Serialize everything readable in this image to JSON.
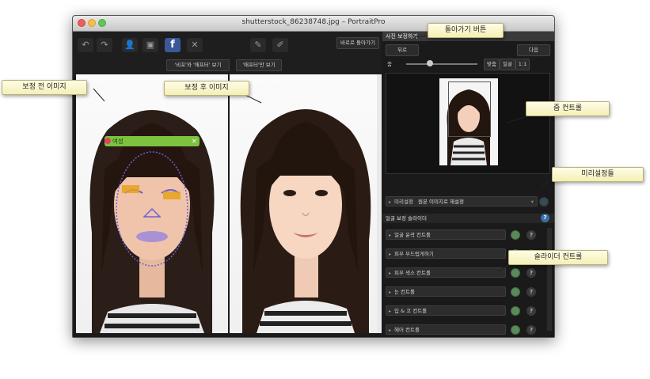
{
  "window": {
    "title": "shutterstock_86238748.jpg – PortraitPro"
  },
  "toolbar": {
    "undo_icon": "undo-icon",
    "redo_icon": "redo-icon",
    "facebook_label": "f",
    "close_label": "✕",
    "revert_label": "바로로 돌아가기",
    "tab_before_after": "'비포'와 '애프터' 보기",
    "tab_after_only": "'애프터'만 보기"
  },
  "photo": {
    "gender_label": "여성",
    "gender_close": "✕"
  },
  "panel": {
    "header": "사진 보정하기",
    "back_label": "뒤로",
    "next_label": "다음",
    "zoom_label": "줌",
    "fit_label": "맞춤",
    "face_label": "얼굴",
    "ratio_label": "1:1",
    "preset_label": "미리설정",
    "preset_value": "원본 이미지로 재설정",
    "sliders_header": "얼굴 보정 슬라이더",
    "help_label": "?",
    "sliders": [
      "얼굴 윤곽 컨트롤",
      "피부 부드럽게하기",
      "피부 색소 컨트롤",
      "눈 컨트롤",
      "입 & 코 컨트롤",
      "헤어 컨트롤"
    ]
  },
  "callouts": {
    "back_button": "돌아가기 버튼",
    "before_image": "보정 전 이미지",
    "after_image": "보정 후 이미지",
    "zoom_control": "줌 컨트롤",
    "presets": "미리설정들",
    "slider_controls": "슬라이더 컨트롤"
  }
}
